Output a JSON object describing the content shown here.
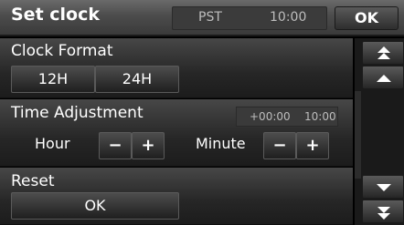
{
  "header": {
    "title": "Set clock",
    "timezone": "PST",
    "time": "10:00",
    "ok_label": "OK"
  },
  "clock_format": {
    "label": "Clock Format",
    "options": [
      "12H",
      "24H"
    ]
  },
  "time_adjustment": {
    "label": "Time Adjustment",
    "offset": "+00:00",
    "time": "10:00",
    "hour_label": "Hour",
    "minute_label": "Minute",
    "minus_label": "−",
    "plus_label": "+"
  },
  "reset": {
    "label": "Reset",
    "ok_label": "OK"
  },
  "scroll": {
    "icons": [
      "scroll-to-top-icon",
      "scroll-up-icon",
      "scroll-down-icon",
      "scroll-to-bottom-icon"
    ]
  }
}
